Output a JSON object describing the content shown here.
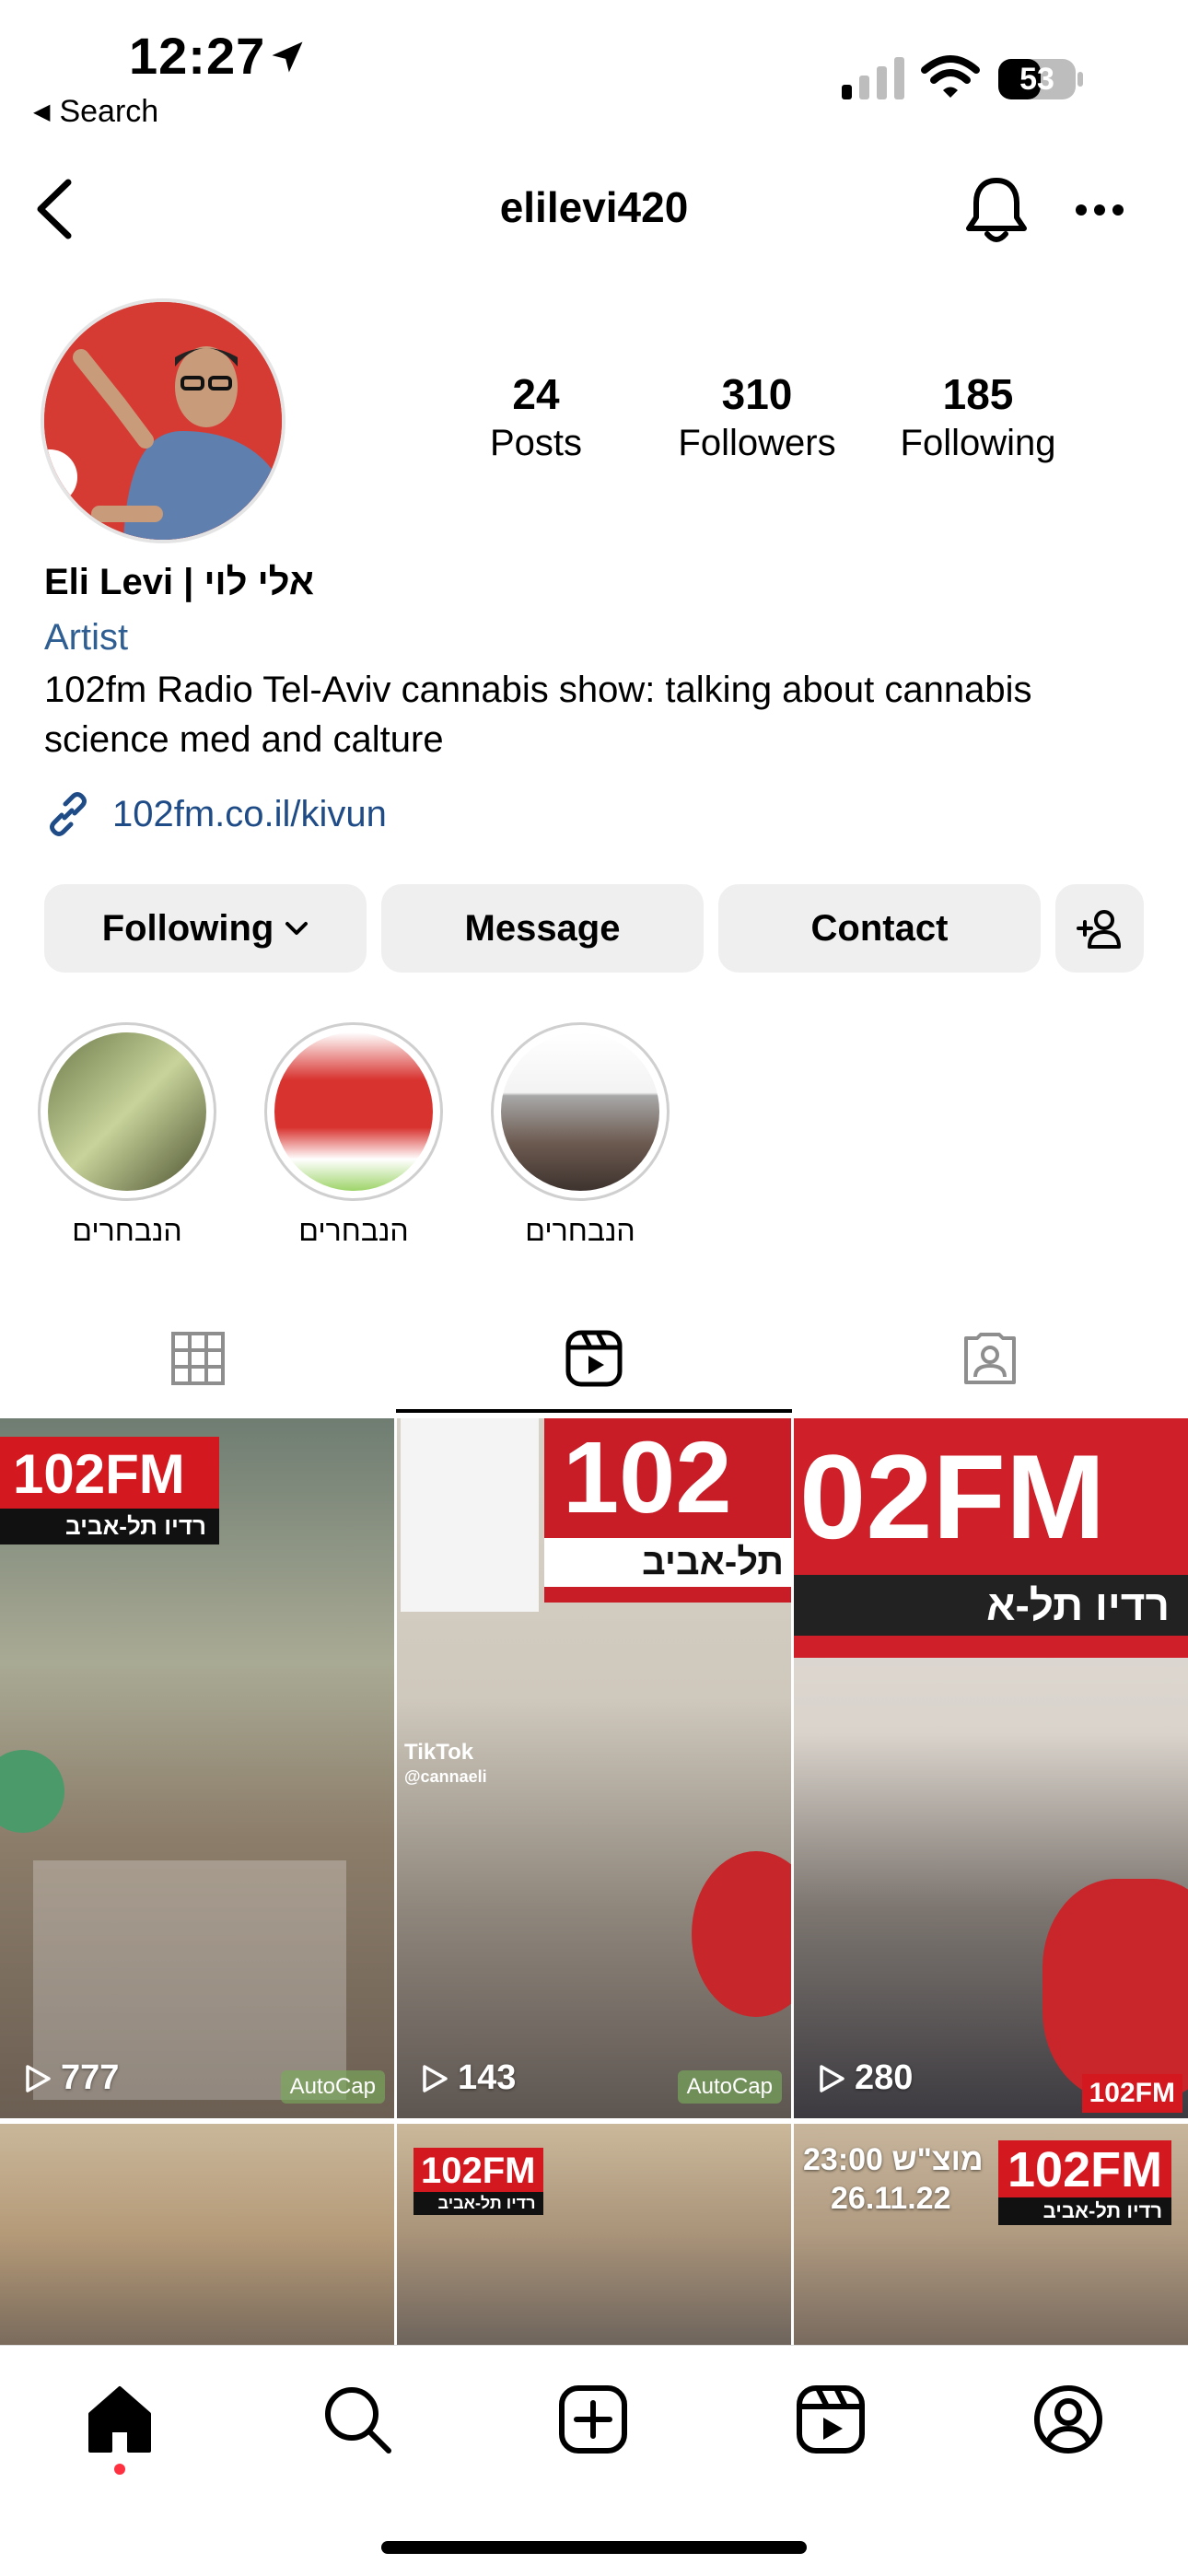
{
  "status_bar": {
    "time": "12:27",
    "back_app": "Search",
    "battery": "53"
  },
  "header": {
    "username": "elilevi420"
  },
  "profile": {
    "stats": [
      {
        "num": "24",
        "label": "Posts"
      },
      {
        "num": "310",
        "label": "Followers"
      },
      {
        "num": "185",
        "label": "Following"
      }
    ],
    "display_name": "Eli Levi | אלי לוי",
    "category": "Artist",
    "bio": "102fm Radio Tel-Aviv cannabis show: talking about cannabis science med and calture",
    "link": "102fm.co.il/kivun"
  },
  "buttons": {
    "following": "Following",
    "message": "Message",
    "contact": "Contact"
  },
  "highlights": [
    {
      "label": "הנבחרים"
    },
    {
      "label": "הנבחרים"
    },
    {
      "label": "הנבחרים"
    }
  ],
  "grid": {
    "items": [
      {
        "views": "777",
        "badge": "AutoCap",
        "brand_top": "102FM",
        "brand_sub": "רדיו תל-אביב"
      },
      {
        "views": "143",
        "badge": "AutoCap",
        "brand_top": "102",
        "brand_sub": "תל-אביב",
        "tiktok": "TikTok",
        "tiktok_user": "@cannaeli"
      },
      {
        "views": "280",
        "badge": "",
        "brand_top": "02FM",
        "brand_sub": "רדיו תל-א",
        "corner_logo": "102FM"
      },
      {
        "brand_top": "",
        "brand_sub": ""
      },
      {
        "brand_top": "102FM",
        "brand_sub": "רדיו תל-אביב"
      },
      {
        "brand_top": "102FM",
        "brand_sub": "רדיו תל-אביב",
        "overlay_line1": "מוצ\"ש 23:00",
        "overlay_line2": "26.11.22"
      }
    ]
  },
  "colors": {
    "link": "#1f4c87",
    "category": "#2f5f92",
    "button_bg": "#efefef",
    "brand_red": "#d4181f",
    "notification_dot": "#ff3040"
  }
}
